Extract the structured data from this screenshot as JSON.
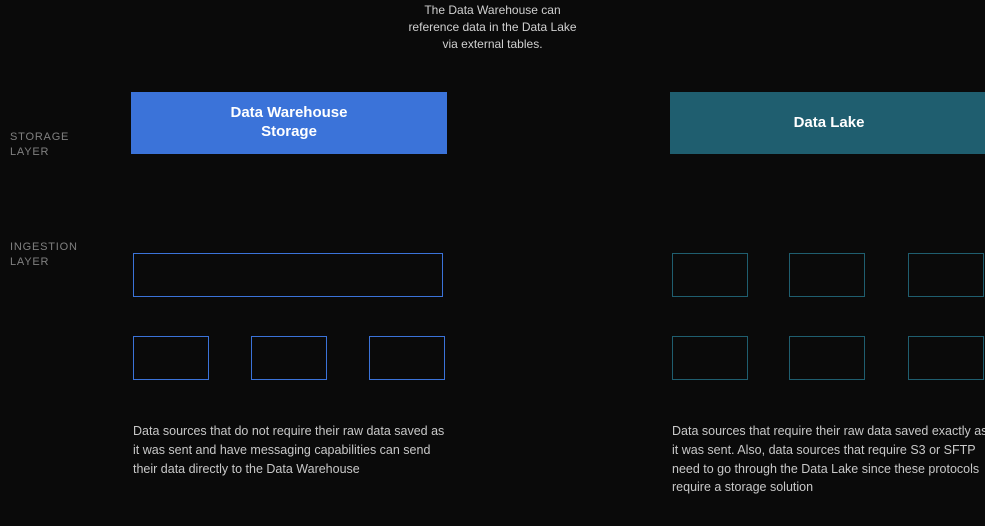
{
  "top_note": "The Data Warehouse can reference data in the Data Lake via external tables.",
  "layers": {
    "storage_label": "STORAGE\nLAYER",
    "ingestion_label": "INGESTION\nLAYER"
  },
  "storage": {
    "warehouse_label": "Data Warehouse\nStorage",
    "lake_label": "Data Lake"
  },
  "descriptions": {
    "left": "Data sources that do not require their raw data saved as it was sent and have messaging capabilities can send their data directly to the Data Warehouse",
    "right": "Data sources that require their raw data saved exactly as it was sent. Also, data sources that require S3 or SFTP need to go through the Data Lake since these protocols require a storage solution"
  },
  "colors": {
    "warehouse": "#3b73d9",
    "lake": "#1f5e6f",
    "bg": "#0a0a0a",
    "text_muted": "#808080",
    "text_body": "#c8c8c8"
  }
}
